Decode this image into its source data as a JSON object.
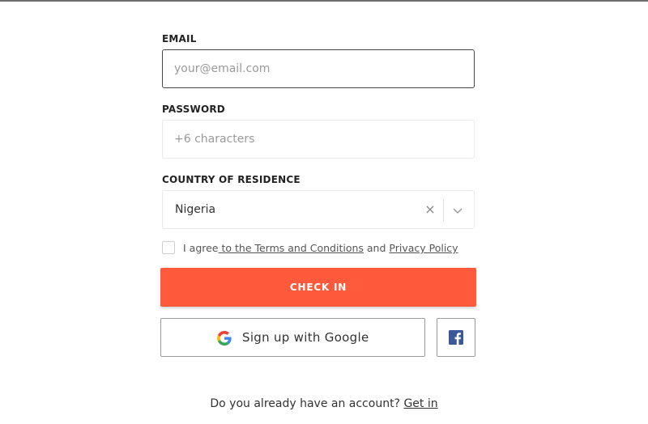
{
  "email": {
    "label": "EMAIL",
    "placeholder": "your@email.com",
    "value": ""
  },
  "password": {
    "label": "PASSWORD",
    "placeholder": "+6 characters",
    "value": ""
  },
  "country": {
    "label": "COUNTRY OF RESIDENCE",
    "selected": "Nigeria",
    "clear_glyph": "×"
  },
  "agreement": {
    "prefix": "I agree",
    "terms_link": " to the Terms and Conditions",
    "conjunction": " and ",
    "privacy_link": "Privacy Policy",
    "checked": false
  },
  "checkin_button": {
    "label": "CHECK IN",
    "color": "#ff5a3c"
  },
  "google_button": {
    "label": "Sign up with Google",
    "icon": "google-icon"
  },
  "facebook_button": {
    "icon": "facebook-icon",
    "color": "#3b5998"
  },
  "footer": {
    "question": "Do you already have an account? ",
    "link": "Get in"
  }
}
